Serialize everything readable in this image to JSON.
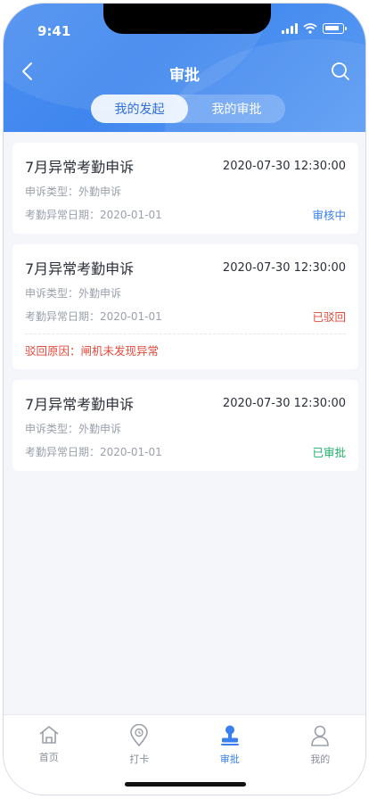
{
  "status_bar": {
    "time": "9:41"
  },
  "nav": {
    "title": "审批"
  },
  "segments": [
    {
      "label": "我的发起",
      "active": true
    },
    {
      "label": "我的审批",
      "active": false
    }
  ],
  "cards": [
    {
      "title": "7月异常考勤申诉",
      "time": "2020-07-30 12:30:00",
      "type": "申诉类型：外勤申诉",
      "date": "考勤异常日期：2020-01-01",
      "status": "审核中",
      "status_color": "#3a7ff0"
    },
    {
      "title": "7月异常考勤申诉",
      "time": "2020-07-30 12:30:00",
      "type": "申诉类型：外勤申诉",
      "date": "考勤异常日期：2020-01-01",
      "status": "已驳回",
      "status_color": "#e5493a",
      "reason": "驳回原因：闸机未发现异常"
    },
    {
      "title": "7月异常考勤申诉",
      "time": "2020-07-30 12:30:00",
      "type": "申诉类型：外勤申诉",
      "date": "考勤异常日期：2020-01-01",
      "status": "已审批",
      "status_color": "#1fae6b"
    }
  ],
  "tabbar": [
    {
      "label": "首页",
      "icon": "home-icon",
      "active": false
    },
    {
      "label": "打卡",
      "icon": "location-pin-icon",
      "active": false
    },
    {
      "label": "审批",
      "icon": "stamp-icon",
      "active": true
    },
    {
      "label": "我的",
      "icon": "user-icon",
      "active": false
    }
  ],
  "colors": {
    "primary": "#3f86ee",
    "reject": "#e5493a",
    "approved": "#1fae6b",
    "pending": "#3a7ff0"
  }
}
